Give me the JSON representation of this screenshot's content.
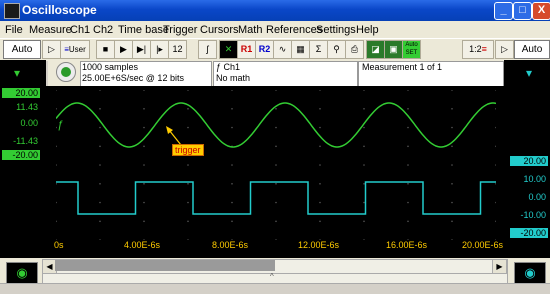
{
  "window": {
    "title": "Oscilloscope",
    "buttons": [
      "_",
      "□",
      "X"
    ]
  },
  "menu": [
    "File",
    "Measure",
    "Ch1",
    "Ch2",
    "Time base",
    "Trigger",
    "Cursors",
    "Math",
    "References",
    "Settings",
    "Help"
  ],
  "toolbar": {
    "left_mode": "Auto",
    "user_label": "User",
    "r1_label": "R1",
    "r2_label": "R2",
    "sum_label": "Σ",
    "auto_set_label": "Auto SET",
    "ratio_label": "1:2",
    "right_mode": "Auto"
  },
  "info": {
    "samples": "1000 samples",
    "rate": "25.00E+6S/sec @ 12 bits",
    "channel": "ƒ Ch1",
    "math": "No math",
    "measurement": "Measurement 1 of 1"
  },
  "scope": {
    "ch1_scale": [
      "20.00",
      "11.43",
      "0.00",
      "-11.43",
      "-20.00"
    ],
    "ch2_scale": [
      "20.00",
      "10.00",
      "0.00",
      "-10.00",
      "-20.00"
    ],
    "time_ticks": [
      "0s",
      "4.00E-6s",
      "8.00E-6s",
      "12.00E-6s",
      "16.00E-6s",
      "20.00E-6s"
    ],
    "trigger_label": "trigger",
    "ch1_marker": "ƒ",
    "colors": {
      "ch1": "#33cc33",
      "ch2": "#22cccc",
      "trigger": "#ffcc00",
      "grid": "#555555"
    }
  }
}
